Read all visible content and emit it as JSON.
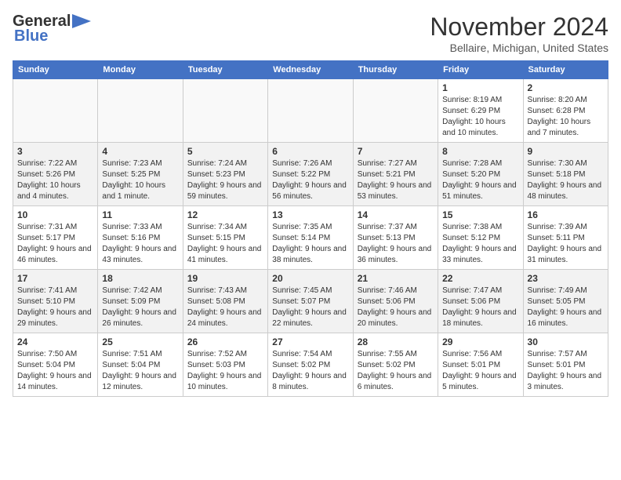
{
  "logo": {
    "line1": "General",
    "line2": "Blue"
  },
  "header": {
    "month_year": "November 2024",
    "location": "Bellaire, Michigan, United States"
  },
  "weekdays": [
    "Sunday",
    "Monday",
    "Tuesday",
    "Wednesday",
    "Thursday",
    "Friday",
    "Saturday"
  ],
  "weeks": [
    [
      {
        "day": "",
        "info": ""
      },
      {
        "day": "",
        "info": ""
      },
      {
        "day": "",
        "info": ""
      },
      {
        "day": "",
        "info": ""
      },
      {
        "day": "",
        "info": ""
      },
      {
        "day": "1",
        "info": "Sunrise: 8:19 AM\nSunset: 6:29 PM\nDaylight: 10 hours and 10 minutes."
      },
      {
        "day": "2",
        "info": "Sunrise: 8:20 AM\nSunset: 6:28 PM\nDaylight: 10 hours and 7 minutes."
      }
    ],
    [
      {
        "day": "3",
        "info": "Sunrise: 7:22 AM\nSunset: 5:26 PM\nDaylight: 10 hours and 4 minutes."
      },
      {
        "day": "4",
        "info": "Sunrise: 7:23 AM\nSunset: 5:25 PM\nDaylight: 10 hours and 1 minute."
      },
      {
        "day": "5",
        "info": "Sunrise: 7:24 AM\nSunset: 5:23 PM\nDaylight: 9 hours and 59 minutes."
      },
      {
        "day": "6",
        "info": "Sunrise: 7:26 AM\nSunset: 5:22 PM\nDaylight: 9 hours and 56 minutes."
      },
      {
        "day": "7",
        "info": "Sunrise: 7:27 AM\nSunset: 5:21 PM\nDaylight: 9 hours and 53 minutes."
      },
      {
        "day": "8",
        "info": "Sunrise: 7:28 AM\nSunset: 5:20 PM\nDaylight: 9 hours and 51 minutes."
      },
      {
        "day": "9",
        "info": "Sunrise: 7:30 AM\nSunset: 5:18 PM\nDaylight: 9 hours and 48 minutes."
      }
    ],
    [
      {
        "day": "10",
        "info": "Sunrise: 7:31 AM\nSunset: 5:17 PM\nDaylight: 9 hours and 46 minutes."
      },
      {
        "day": "11",
        "info": "Sunrise: 7:33 AM\nSunset: 5:16 PM\nDaylight: 9 hours and 43 minutes."
      },
      {
        "day": "12",
        "info": "Sunrise: 7:34 AM\nSunset: 5:15 PM\nDaylight: 9 hours and 41 minutes."
      },
      {
        "day": "13",
        "info": "Sunrise: 7:35 AM\nSunset: 5:14 PM\nDaylight: 9 hours and 38 minutes."
      },
      {
        "day": "14",
        "info": "Sunrise: 7:37 AM\nSunset: 5:13 PM\nDaylight: 9 hours and 36 minutes."
      },
      {
        "day": "15",
        "info": "Sunrise: 7:38 AM\nSunset: 5:12 PM\nDaylight: 9 hours and 33 minutes."
      },
      {
        "day": "16",
        "info": "Sunrise: 7:39 AM\nSunset: 5:11 PM\nDaylight: 9 hours and 31 minutes."
      }
    ],
    [
      {
        "day": "17",
        "info": "Sunrise: 7:41 AM\nSunset: 5:10 PM\nDaylight: 9 hours and 29 minutes."
      },
      {
        "day": "18",
        "info": "Sunrise: 7:42 AM\nSunset: 5:09 PM\nDaylight: 9 hours and 26 minutes."
      },
      {
        "day": "19",
        "info": "Sunrise: 7:43 AM\nSunset: 5:08 PM\nDaylight: 9 hours and 24 minutes."
      },
      {
        "day": "20",
        "info": "Sunrise: 7:45 AM\nSunset: 5:07 PM\nDaylight: 9 hours and 22 minutes."
      },
      {
        "day": "21",
        "info": "Sunrise: 7:46 AM\nSunset: 5:06 PM\nDaylight: 9 hours and 20 minutes."
      },
      {
        "day": "22",
        "info": "Sunrise: 7:47 AM\nSunset: 5:06 PM\nDaylight: 9 hours and 18 minutes."
      },
      {
        "day": "23",
        "info": "Sunrise: 7:49 AM\nSunset: 5:05 PM\nDaylight: 9 hours and 16 minutes."
      }
    ],
    [
      {
        "day": "24",
        "info": "Sunrise: 7:50 AM\nSunset: 5:04 PM\nDaylight: 9 hours and 14 minutes."
      },
      {
        "day": "25",
        "info": "Sunrise: 7:51 AM\nSunset: 5:04 PM\nDaylight: 9 hours and 12 minutes."
      },
      {
        "day": "26",
        "info": "Sunrise: 7:52 AM\nSunset: 5:03 PM\nDaylight: 9 hours and 10 minutes."
      },
      {
        "day": "27",
        "info": "Sunrise: 7:54 AM\nSunset: 5:02 PM\nDaylight: 9 hours and 8 minutes."
      },
      {
        "day": "28",
        "info": "Sunrise: 7:55 AM\nSunset: 5:02 PM\nDaylight: 9 hours and 6 minutes."
      },
      {
        "day": "29",
        "info": "Sunrise: 7:56 AM\nSunset: 5:01 PM\nDaylight: 9 hours and 5 minutes."
      },
      {
        "day": "30",
        "info": "Sunrise: 7:57 AM\nSunset: 5:01 PM\nDaylight: 9 hours and 3 minutes."
      }
    ]
  ]
}
